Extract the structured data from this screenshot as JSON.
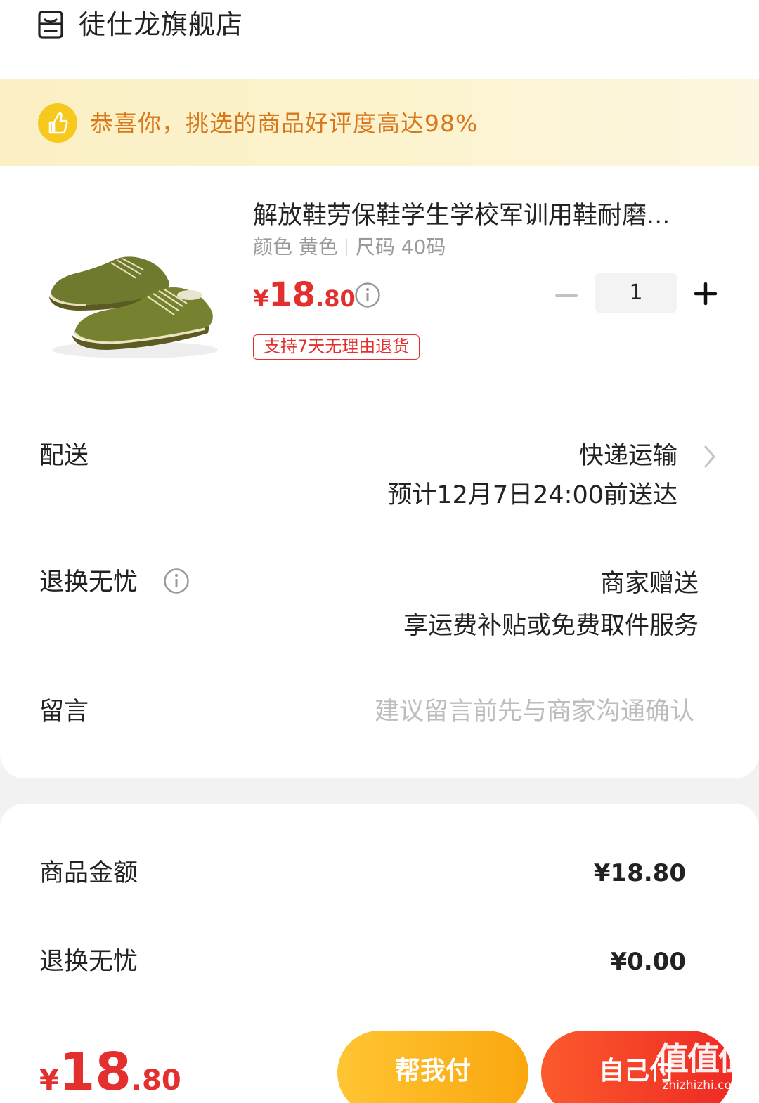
{
  "store": {
    "name": "徒仕龙旗舰店",
    "icon": "store-icon"
  },
  "banner": {
    "text": "恭喜你，挑选的商品好评度高达98%",
    "icon": "thumbs-up-icon"
  },
  "product": {
    "title": "解放鞋劳保鞋学生学校军训用鞋耐磨...",
    "color": "颜色 黄色",
    "size": "尺码 40码",
    "price": {
      "currency": "¥",
      "integer": "18",
      "decimal": ".80"
    },
    "quantity": "1",
    "return_badge": "支持7天无理由退货"
  },
  "delivery": {
    "label": "配送",
    "method": "快递运输",
    "estimate": "预计12月7日24:00前送达"
  },
  "return_service": {
    "label": "退换无忧",
    "value": "商家赠送",
    "detail": "享运费补贴或免费取件服务"
  },
  "note": {
    "label": "留言",
    "placeholder": "建议留言前先与商家沟通确认"
  },
  "summary": {
    "goods_amount_label": "商品金额",
    "goods_amount": "¥18.80",
    "return_label": "退换无忧",
    "return_amount": "¥0.00"
  },
  "footer": {
    "total": {
      "currency": "¥",
      "integer": "18",
      "decimal": ".80"
    },
    "help_pay_label": "帮我付",
    "self_pay_label": "自己付"
  },
  "watermark": {
    "text_cn": "值值值",
    "text_en": "zhizhizhi.com"
  },
  "colors": {
    "accent_red": "#e3302e",
    "accent_orange": "#f9a70f",
    "banner_text": "#d9771b"
  }
}
